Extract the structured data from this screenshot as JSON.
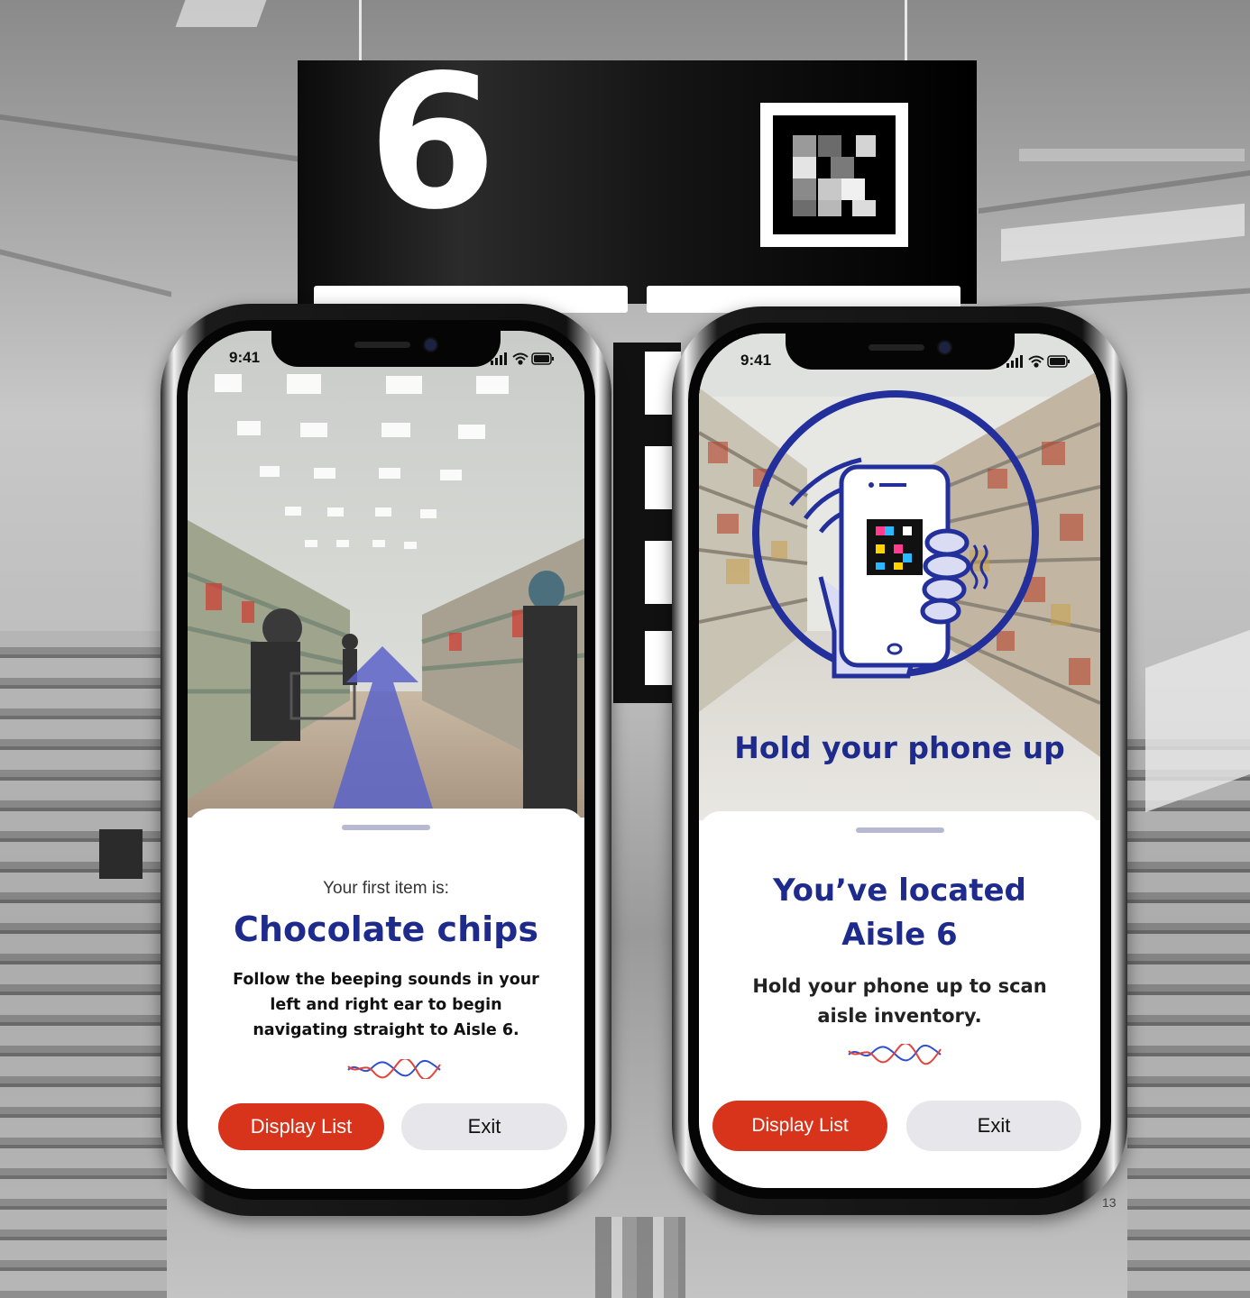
{
  "scene": {
    "aisle_number": "6",
    "page_number": "13"
  },
  "phone_left": {
    "status_time": "9:41",
    "eyebrow": "Your first item is:",
    "item_name": "Chocolate chips",
    "instructions": "Follow the beeping sounds in your left and right ear to begin navigating straight to Aisle 6.",
    "primary_button": "Display List",
    "secondary_button": "Exit",
    "icons": [
      "signal-icon",
      "wifi-icon",
      "battery-icon",
      "direction-arrow-icon",
      "sound-wave-icon"
    ]
  },
  "phone_right": {
    "status_time": "9:41",
    "overlay_title": "Hold your phone up",
    "headline_line1": "You’ve located",
    "headline_line2": "Aisle 6",
    "instructions_line1": "Hold your phone up to scan",
    "instructions_line2": "aisle inventory.",
    "primary_button": "Display List",
    "secondary_button": "Exit",
    "icons": [
      "signal-icon",
      "wifi-icon",
      "battery-icon",
      "hand-holding-phone-icon",
      "sound-wave-icon"
    ]
  },
  "colors": {
    "brand_navy": "#1e2a8c",
    "primary_red": "#d8341b",
    "secondary_gray": "#e7e7eb",
    "arrow_blue": "#5b63c8"
  }
}
